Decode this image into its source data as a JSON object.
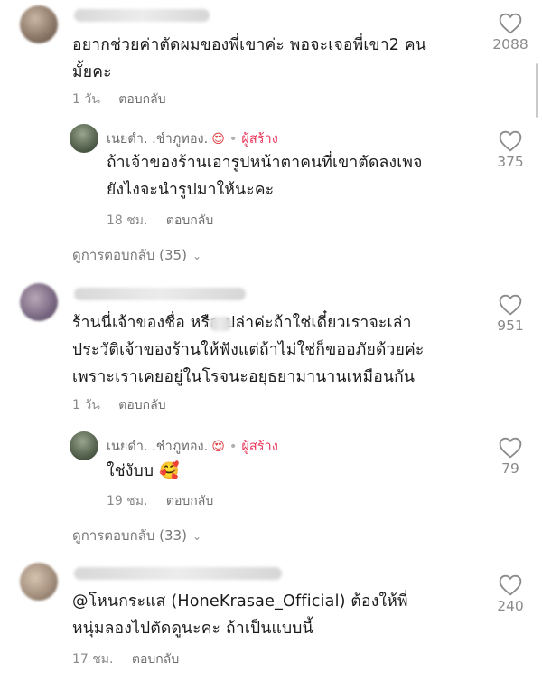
{
  "comments": [
    {
      "text_lines": [
        "อยากช่วยค่าตัดผมของพี่เขาค่ะ พอจะเจอพี่เขา2 คน",
        "มั้ยคะ"
      ],
      "time": "1 วัน",
      "reply_label": "ตอบกลับ",
      "likes": "2088",
      "reply": {
        "author": "เนยดำ. .ชำภูทอง.",
        "author_emoji": "😍",
        "creator_label": "ผู้สร้าง",
        "text_lines": [
          "ถ้าเจ้าของร้านเอารูปหน้าตาคนที่เขาตัดลงเพจ",
          "ยังไงจะนำรูปมาให้นะคะ"
        ],
        "time": "18 ชม.",
        "reply_label": "ตอบกลับ",
        "likes": "375"
      },
      "view_replies": "ดูการตอบกลับ (35)"
    },
    {
      "text_lines": [
        "ร้านนี่เจ้าของชื่อ    หรือเปล่าค่ะถ้าใช่เดี๋ยวเราจะเล่า",
        "ประวัติเจ้าของร้านให้ฟังแต่ถ้าไม่ใช่ก็ขออภัยด้วยค่ะ",
        "เพราะเราเคยอยู่ในโรจนะอยุธยามานานเหมือนกัน"
      ],
      "time": "1 วัน",
      "reply_label": "ตอบกลับ",
      "likes": "951",
      "reply": {
        "author": "เนยดำ. .ชำภูทอง.",
        "author_emoji": "😍",
        "creator_label": "ผู้สร้าง",
        "text": "ใช่งับบ",
        "text_emoji": "🥰",
        "time": "19 ชม.",
        "reply_label": "ตอบกลับ",
        "likes": "79"
      },
      "view_replies": "ดูการตอบกลับ (33)"
    },
    {
      "text_lines": [
        "@โหนกระแส (HoneKrasae_Official) ต้องให้พี่",
        "หนุ่มลองไปตัดดูนะคะ ถ้าเป็นแบบนี้"
      ],
      "time": "17 ชม.",
      "reply_label": "ตอบกลับ",
      "likes": "240"
    }
  ],
  "icons": {
    "like": "heart-outline-icon",
    "expand": "chevron-down-icon"
  },
  "colors": {
    "creator": "#e8375b",
    "secondary_text": "#8a8a8a",
    "primary_text": "#1a1a1a"
  }
}
